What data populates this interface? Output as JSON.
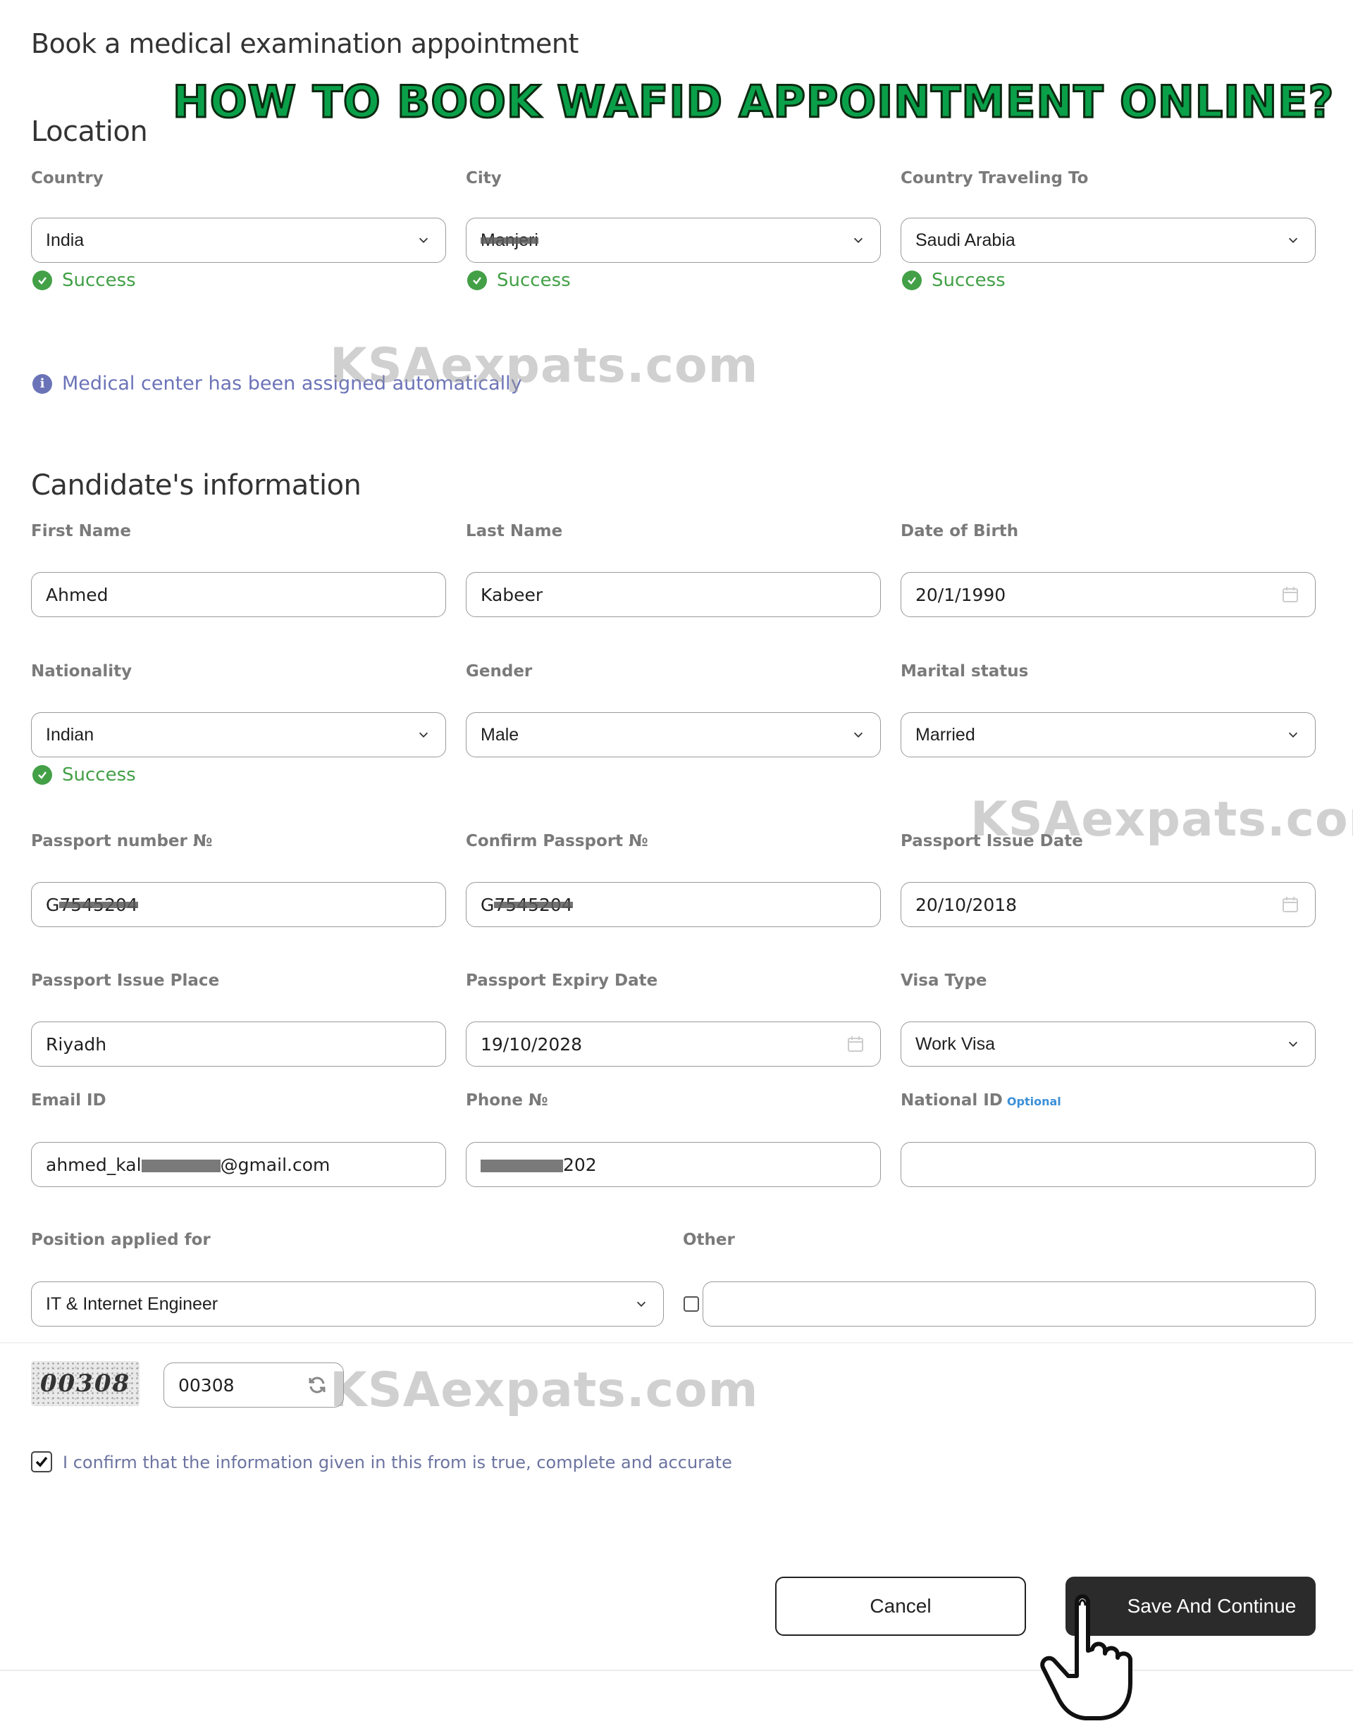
{
  "page": {
    "title": "Book a medical examination appointment",
    "banner": "HOW TO BOOK WAFID APPOINTMENT ONLINE?",
    "watermark": "KSAexpats.com"
  },
  "location": {
    "heading": "Location",
    "country": {
      "label": "Country",
      "value": "India",
      "status": "Success"
    },
    "city": {
      "label": "City",
      "value": "Manjeri",
      "status": "Success"
    },
    "traveling_to": {
      "label": "Country Traveling To",
      "value": "Saudi Arabia",
      "status": "Success"
    },
    "notice": "Medical center has been assigned automatically"
  },
  "candidate": {
    "heading": "Candidate's information",
    "first_name": {
      "label": "First Name",
      "value": "Ahmed"
    },
    "last_name": {
      "label": "Last Name",
      "value": "Kabeer"
    },
    "dob": {
      "label": "Date of Birth",
      "value": "20/1/1990"
    },
    "nationality": {
      "label": "Nationality",
      "value": "Indian",
      "status": "Success"
    },
    "gender": {
      "label": "Gender",
      "value": "Male"
    },
    "marital": {
      "label": "Marital status",
      "value": "Married"
    },
    "passport": {
      "label": "Passport number №",
      "prefix": "G",
      "masked": "7545204"
    },
    "confirm_passport": {
      "label": "Confirm Passport №",
      "prefix": "G",
      "masked": "7545204"
    },
    "issue_date": {
      "label": "Passport Issue Date",
      "value": "20/10/2018"
    },
    "issue_place": {
      "label": "Passport Issue Place",
      "value": "Riyadh"
    },
    "expiry_date": {
      "label": "Passport Expiry Date",
      "value": "19/10/2028"
    },
    "visa_type": {
      "label": "Visa Type",
      "value": "Work Visa"
    },
    "email": {
      "label": "Email ID",
      "prefix": "ahmed_kal",
      "suffix": "@gmail.com"
    },
    "phone": {
      "label": "Phone №",
      "suffix": "202"
    },
    "national_id": {
      "label": "National ID",
      "optional": "Optional",
      "value": ""
    },
    "position": {
      "label": "Position applied for",
      "value": "IT & Internet Engineer"
    },
    "other": {
      "label": "Other",
      "value": ""
    }
  },
  "captcha": {
    "image_text": "00308",
    "value": "00308"
  },
  "confirm": {
    "text": "I confirm that the information given in this from is true, complete and accurate",
    "checked": true
  },
  "actions": {
    "cancel": "Cancel",
    "save": "Save And Continue"
  },
  "colors": {
    "success": "#43a047",
    "info": "#6b73b8",
    "primary_button": "#2b2b2b",
    "banner": "#0aa04a"
  }
}
